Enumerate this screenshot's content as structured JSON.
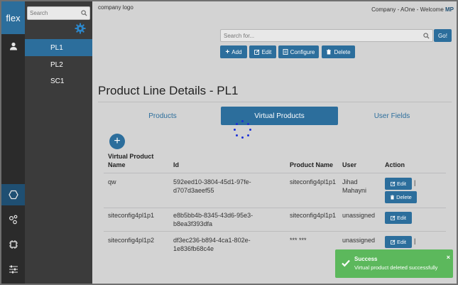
{
  "rail": {
    "logo": "flex",
    "icons": [
      "user-icon",
      "hexagon-icon",
      "share-nodes-icon",
      "chip-icon",
      "sliders-icon"
    ]
  },
  "sidebar": {
    "search_placeholder": "Search",
    "items": [
      {
        "label": "PL1",
        "active": true
      },
      {
        "label": "PL2",
        "active": false
      },
      {
        "label": "SC1",
        "active": false
      }
    ]
  },
  "header": {
    "logo_text": "company logo",
    "welcome_text": "Company - AOne - Welcome ",
    "user_initials": "MP"
  },
  "search": {
    "placeholder": "Search for...",
    "go_label": "Go!"
  },
  "toolbar": {
    "add_label": "Add",
    "edit_label": "Edit",
    "configure_label": "Configure",
    "delete_label": "Delete"
  },
  "page": {
    "title": "Product Line Details - PL1"
  },
  "tabs": [
    {
      "label": "Products",
      "active": false
    },
    {
      "label": "Virtual Products",
      "active": true
    },
    {
      "label": "User Fields",
      "active": false
    }
  ],
  "table": {
    "add_label": "+",
    "columns": [
      "Virtual Product Name",
      "Id",
      "Product Name",
      "User",
      "Action"
    ],
    "rows": [
      {
        "name": "qw",
        "id": "592eed10-3804-45d1-97fe-d707d3aeef55",
        "product": "siteconfig4pl1p1",
        "user": "Jihad Mahayni"
      },
      {
        "name": "siteconfig4pl1p1",
        "id": "e8b5bb4b-8345-43d6-95e3-b8ea3f393dfa",
        "product": "siteconfig4pl1p1",
        "user": "unassigned"
      },
      {
        "name": "siteconfig4pl1p2",
        "id": "df3ec236-b894-4ca1-802e-1e836fb68c4e",
        "product": "*** ***",
        "user": "unassigned"
      }
    ],
    "edit_label": "Edit",
    "delete_label": "Delete",
    "pipe": "|"
  },
  "toast": {
    "title": "Success",
    "message": "Virtual product deleted successfully",
    "close": "×",
    "color": "#5cb85c"
  },
  "colors": {
    "accent": "#2c6e9c",
    "rail": "#2b2b2b",
    "sidebar": "#3b3b3b",
    "content": "#d3d3d3"
  }
}
